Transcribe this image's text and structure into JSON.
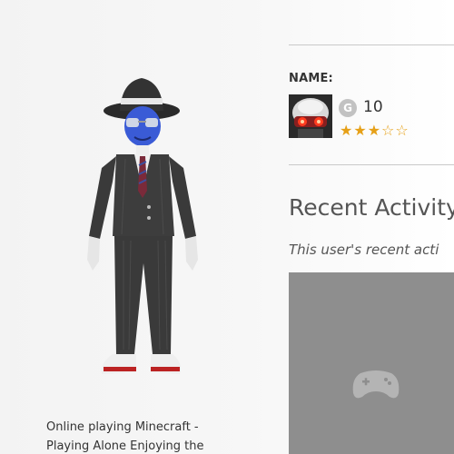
{
  "profile": {
    "name_label": "NAME:",
    "gamerscore_icon": "G",
    "gamerscore": "10",
    "reputation_stars": 3,
    "reputation_max": 5,
    "gamerpic_icon": "robot-gamerpic"
  },
  "presence": {
    "line1": "Online playing Minecraft -",
    "line2": "Playing Alone Enjoying the"
  },
  "recent_activity": {
    "title": "Recent Activity",
    "description": "This user's recent acti",
    "tile_icon": "controller-icon"
  },
  "colors": {
    "star": "#e6a017",
    "tile": "#8e8e8e",
    "divider": "#c9c9c9"
  }
}
